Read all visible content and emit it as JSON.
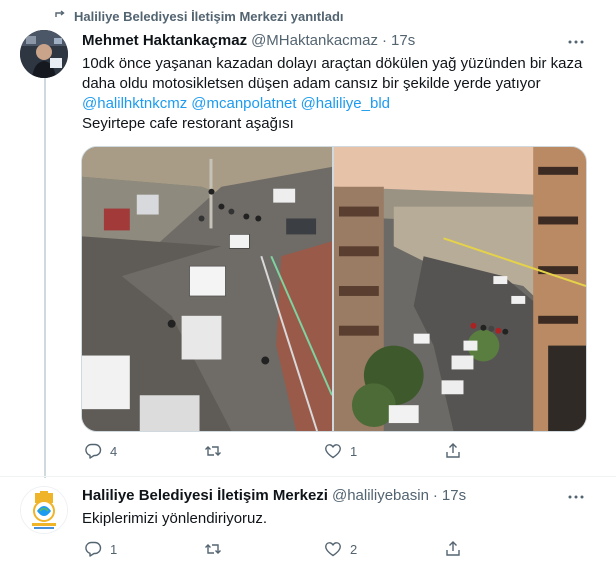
{
  "reply_context": {
    "text": "Haliliye Belediyesi İletişim Merkezi yanıtladı"
  },
  "tweet1": {
    "name": "Mehmet Haktankaçmaz",
    "handle": "@MHaktankacmaz",
    "separator": "·",
    "time": "17s",
    "text_lines": [
      "10dk önce yaşanan kazadan dolayı araçtan dökülen yağ yüzünden bir kaza",
      "daha oldu motosikletsen düşen adam cansız bir şekilde yerde yatıyor"
    ],
    "mentions": [
      "@halilhktnkcmz",
      "@mcanpolatnet",
      "@haliliye_bld"
    ],
    "last_line": "Seyirtepe cafe restorant aşağısı",
    "actions": {
      "reply_count": "4",
      "retweet_count": "",
      "like_count": "1",
      "share_count": ""
    }
  },
  "tweet2": {
    "name": "Haliliye Belediyesi İletişim Merkezi",
    "handle": "@haliliyebasin",
    "separator": "·",
    "time": "17s",
    "text": "Ekiplerimizi yönlendiriyoruz.",
    "actions": {
      "reply_count": "1",
      "retweet_count": "",
      "like_count": "2",
      "share_count": ""
    }
  },
  "colors": {
    "text_primary": "#0f1419",
    "text_secondary": "#536471",
    "link": "#1d9bf0",
    "border": "#cfd9de"
  },
  "icons": {
    "reply_context": "retweet-arrow-icon",
    "more": "more-dots-icon",
    "reply": "reply-bubble-icon",
    "retweet": "retweet-icon",
    "like": "heart-icon",
    "share": "share-upload-icon"
  }
}
